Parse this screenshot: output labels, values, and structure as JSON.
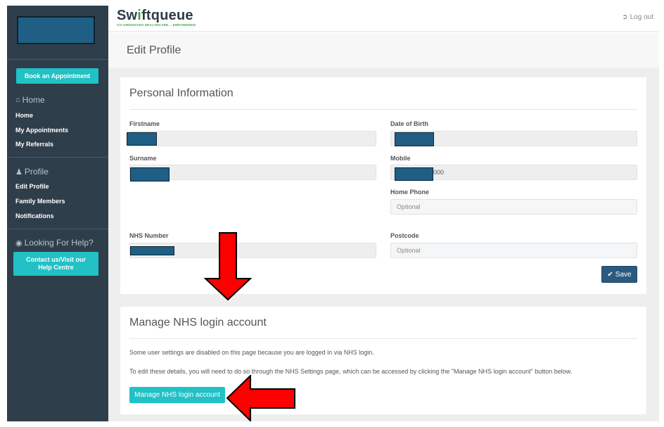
{
  "sidebar": {
    "book_button": "Book an Appointment",
    "home_section": {
      "icon": "home-icon",
      "title": "Home",
      "items": [
        "Home",
        "My Appointments",
        "My Referrals"
      ]
    },
    "profile_section": {
      "icon": "user-icon",
      "title": "Profile",
      "items": [
        "Edit Profile",
        "Family Members",
        "Notifications"
      ]
    },
    "help_section": {
      "icon": "lifebuoy-icon",
      "title": "Looking For Help?",
      "button_line1": "Contact us/Visit our",
      "button_line2": "Help Centre"
    }
  },
  "header": {
    "brand_before": "Sw",
    "brand_highlight": "i",
    "brand_after": "ftqueue",
    "brand_tagline": "CO-ORDINATED HEALTHCARE... EMPOWERED",
    "logout_icon": "sign-out-icon",
    "logout_label": "Log out"
  },
  "page": {
    "title": "Edit Profile"
  },
  "personal": {
    "title": "Personal Information",
    "firstname_label": "Firstname",
    "surname_label": "Surname",
    "nhs_label": "NHS Number",
    "dob_label": "Date of Birth",
    "mobile_label": "Mobile",
    "mobile_visible_suffix": "000",
    "home_phone_label": "Home Phone",
    "home_phone_placeholder": "Optional",
    "postcode_label": "Postcode",
    "postcode_placeholder": "Optional",
    "save_icon": "check-icon",
    "save_label": "Save"
  },
  "nhs": {
    "title": "Manage NHS login account",
    "para1": "Some user settings are disabled on this page because you are logged in via NHS login.",
    "para2": "To edit these details, you will need to do so through the NHS Settings page, which can be accessed by clicking the \"Manage NHS login account\" button below.",
    "button_label": "Manage NHS login account"
  },
  "colors": {
    "sidebar_bg": "#2f3e4b",
    "accent_teal": "#21c1c5",
    "save_blue": "#2b5a80",
    "redaction": "#1f5f86",
    "arrow_red": "#ff0000",
    "brand_green": "#3aa63f"
  }
}
